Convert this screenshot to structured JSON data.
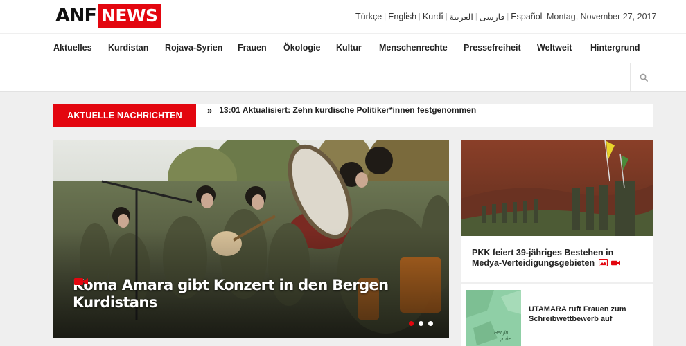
{
  "header": {
    "logo_part1": "ANF",
    "logo_part2": "NEWS",
    "languages": [
      "Türkçe",
      "English",
      "Kurdî",
      "العربية",
      "فارسی",
      "Español"
    ],
    "date": "Montag, November 27, 2017"
  },
  "nav": {
    "items": [
      "Aktuelles",
      "Kurdistan",
      "Rojava-Syrien",
      "Frauen",
      "Ökologie",
      "Kultur",
      "Menschenrechte",
      "Pressefreiheit",
      "Weltweit",
      "Hintergrund"
    ]
  },
  "ticker": {
    "label": "AKTUELLE NACHRICHTEN",
    "text": "13:01 Aktualisiert: Zehn kurdische Politiker*innen festgenommen"
  },
  "hero": {
    "title": "Koma Amara gibt Konzert in den Bergen Kurdistans",
    "slide_count": 3,
    "active_slide": 1
  },
  "side_stories": [
    {
      "title": "PKK feiert 39-jähriges Bestehen in Medya-Verteidigungsgebieten"
    },
    {
      "title": "UTAMARA ruft Frauen zum Schreibwettbewerb auf",
      "thumb_text": [
        "Her jin",
        "çroke"
      ]
    }
  ],
  "colors": {
    "brand_red": "#e3060f",
    "header_bg": "#ffffff",
    "page_bg": "#efefef"
  },
  "icons": {
    "search": "search-icon",
    "video": "video-camera-icon",
    "photo": "photo-icon"
  }
}
